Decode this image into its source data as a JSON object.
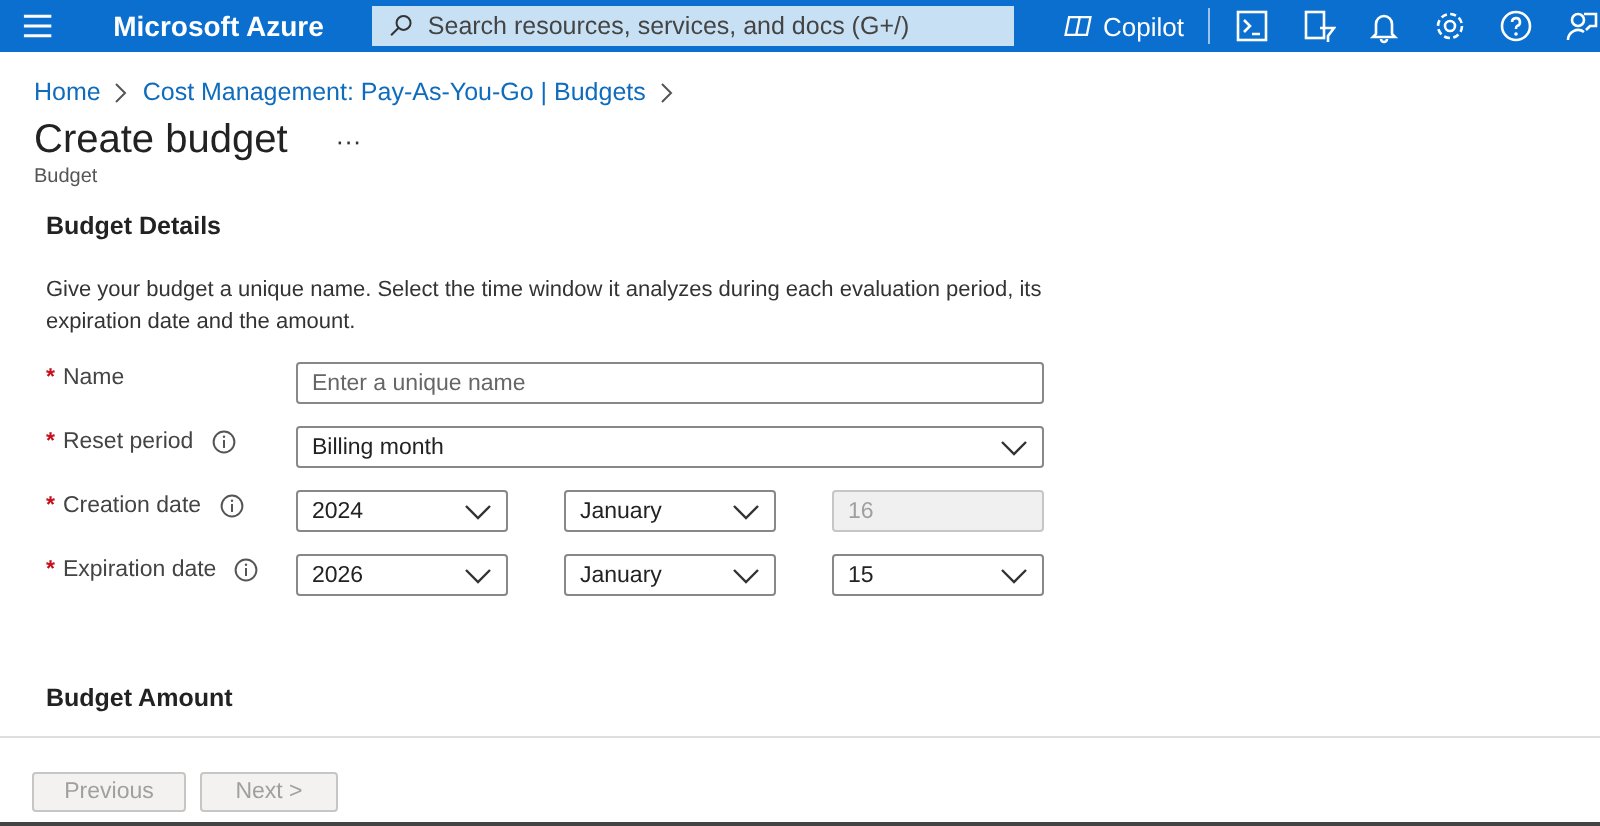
{
  "topbar": {
    "brand": "Microsoft Azure",
    "search": {
      "placeholder": "Search resources, services, and docs (G+/)"
    },
    "copilot": "Copilot"
  },
  "breadcrumb": [
    "Home",
    "Cost Management: Pay-As-You-Go | Budgets"
  ],
  "header": {
    "title": "Create budget",
    "more": "···",
    "subtitle": "Budget"
  },
  "details": {
    "heading": "Budget Details",
    "description": "Give your budget a unique name. Select the time window it analyzes during each evaluation period, its expiration date and the amount.",
    "fields": [
      {
        "label": "Name",
        "required": "*",
        "controls": [
          {
            "kind": "text",
            "placeholder": "Enter a unique name",
            "disabled": false
          }
        ]
      },
      {
        "label": "Reset period",
        "required": "*",
        "info": true,
        "controls": [
          {
            "kind": "select",
            "value": "Billing month",
            "disabled": false
          }
        ]
      },
      {
        "label": "Creation date",
        "required": "*",
        "info": true,
        "controls": [
          {
            "kind": "select",
            "value": "2024",
            "disabled": false
          },
          {
            "kind": "select",
            "value": "January",
            "disabled": false
          },
          {
            "kind": "text",
            "value": "16",
            "disabled": true
          }
        ]
      },
      {
        "label": "Expiration date",
        "required": "*",
        "info": true,
        "controls": [
          {
            "kind": "select",
            "value": "2026",
            "disabled": false
          },
          {
            "kind": "select",
            "value": "January",
            "disabled": false
          },
          {
            "kind": "select",
            "value": "15",
            "disabled": false
          }
        ]
      }
    ]
  },
  "amount": {
    "heading": "Budget Amount"
  },
  "buttons": [
    {
      "label": "Previous",
      "disabled": true
    },
    {
      "label": "Next >",
      "disabled": true
    }
  ]
}
